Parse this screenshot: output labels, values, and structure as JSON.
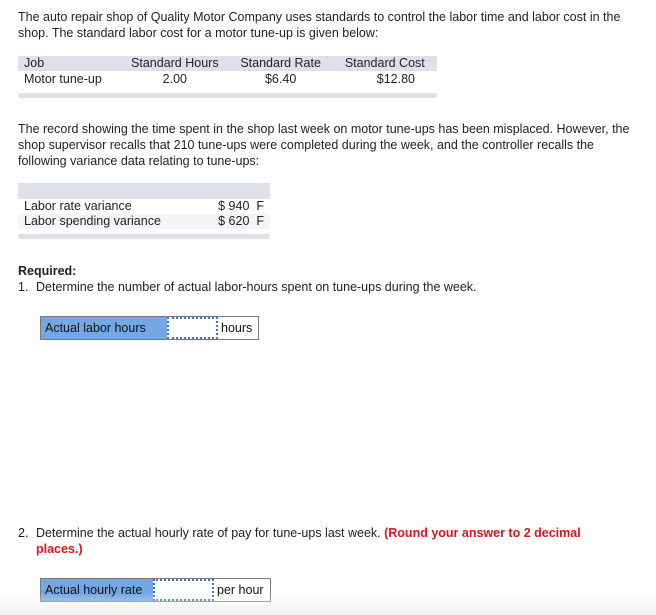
{
  "intro_text": "The auto repair shop of Quality Motor Company uses standards to control the labor time and labor cost in the shop. The standard labor cost for a motor tune-up is given below:",
  "standards_table": {
    "headers": [
      "Job",
      "Standard Hours",
      "Standard Rate",
      "Standard Cost"
    ],
    "rows": [
      [
        "Motor tune-up",
        "2.00",
        "$6.40",
        "$12.80"
      ]
    ]
  },
  "record_text": "The record showing the time spent in the shop last week on motor tune-ups has been misplaced. However, the shop supervisor recalls that 210 tune-ups were completed during the week, and the controller recalls the following variance data relating to tune-ups:",
  "variance_table": {
    "rows": [
      {
        "label": "Labor rate variance",
        "amount": "$ 940",
        "flag": "F"
      },
      {
        "label": "Labor spending variance",
        "amount": "$ 620",
        "flag": "F"
      }
    ]
  },
  "required": {
    "title": "Required:",
    "questions": [
      {
        "number": "1.",
        "text": "Determine the number of actual labor-hours spent on tune-ups during the week.",
        "hint": "",
        "answer": {
          "label": "Actual labor hours",
          "value": "",
          "unit": "hours"
        }
      },
      {
        "number": "2.",
        "text": "Determine the actual hourly rate of pay for tune-ups last week.",
        "hint": "(Round your answer to 2 decimal places.)",
        "answer": {
          "label": "Actual hourly rate",
          "value": "",
          "unit": "per hour"
        }
      }
    ]
  },
  "colors": {
    "table_header_bg": "#dfe1e9",
    "answer_label_bg": "#74a8e2",
    "input_border": "#3f74c2",
    "hint_red": "#e0141e"
  }
}
